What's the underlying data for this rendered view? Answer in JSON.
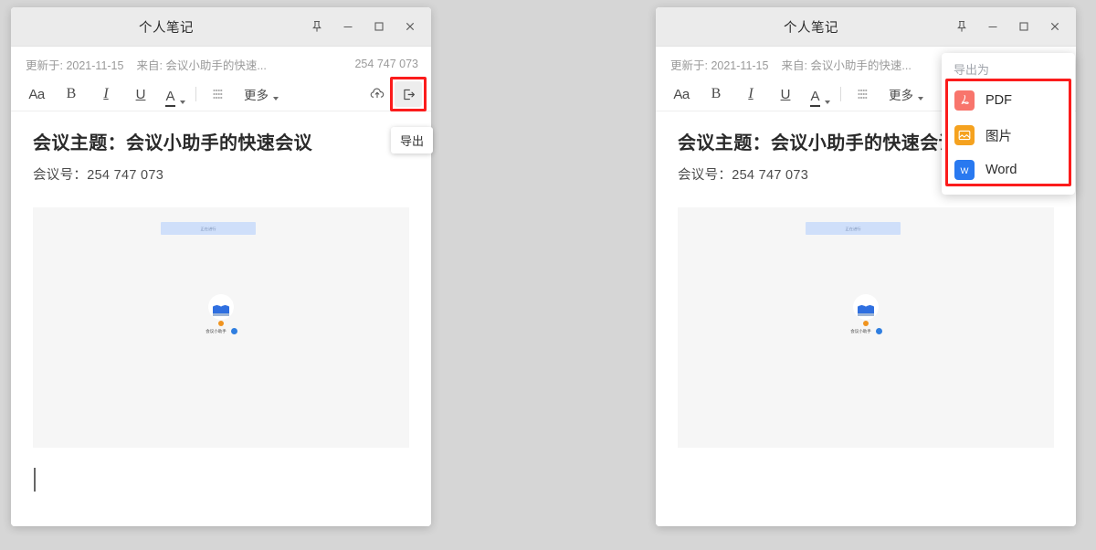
{
  "window": {
    "title": "个人笔记",
    "controls": [
      {
        "name": "pin",
        "icon": "pin-icon"
      },
      {
        "name": "minimize",
        "icon": "minimize-icon"
      },
      {
        "name": "maximize",
        "icon": "maximize-icon"
      },
      {
        "name": "close",
        "icon": "close-icon"
      }
    ]
  },
  "meta": {
    "updated_label": "更新于: 2021-11-15",
    "from_label": "来自: 会议小助手的快速...",
    "meeting_code": "254 747 073"
  },
  "toolbar": {
    "font_size_label": "Aa",
    "bold_label": "B",
    "italic_label": "I",
    "underline_label": "U",
    "font_color_label": "A",
    "list_icon": "bullet-list-icon",
    "more_label": "更多",
    "cloud_icon": "cloud-upload-icon",
    "export_icon": "export-icon",
    "export_tooltip": "导出"
  },
  "document": {
    "title": "会议主题：会议小助手的快速会议",
    "subtitle": "会议号：254 747 073",
    "embed": {
      "banner_text": "正在进行",
      "avatar_label": "会议小助手",
      "avatar_icon": "meeting-avatar-icon",
      "badge_icon": "user-badge-icon",
      "status_dot_color": "#f0941f"
    }
  },
  "dropdown": {
    "header": "导出为",
    "items": [
      {
        "label": "PDF",
        "icon": "pdf-icon",
        "color": "#f8756c",
        "glyph": "人"
      },
      {
        "label": "图片",
        "icon": "image-icon",
        "color": "#f5a21f",
        "glyph": "▣"
      },
      {
        "label": "Word",
        "icon": "word-icon",
        "color": "#2979f0",
        "glyph": "W"
      }
    ]
  },
  "highlight": {
    "color": "#fb1c1c"
  }
}
